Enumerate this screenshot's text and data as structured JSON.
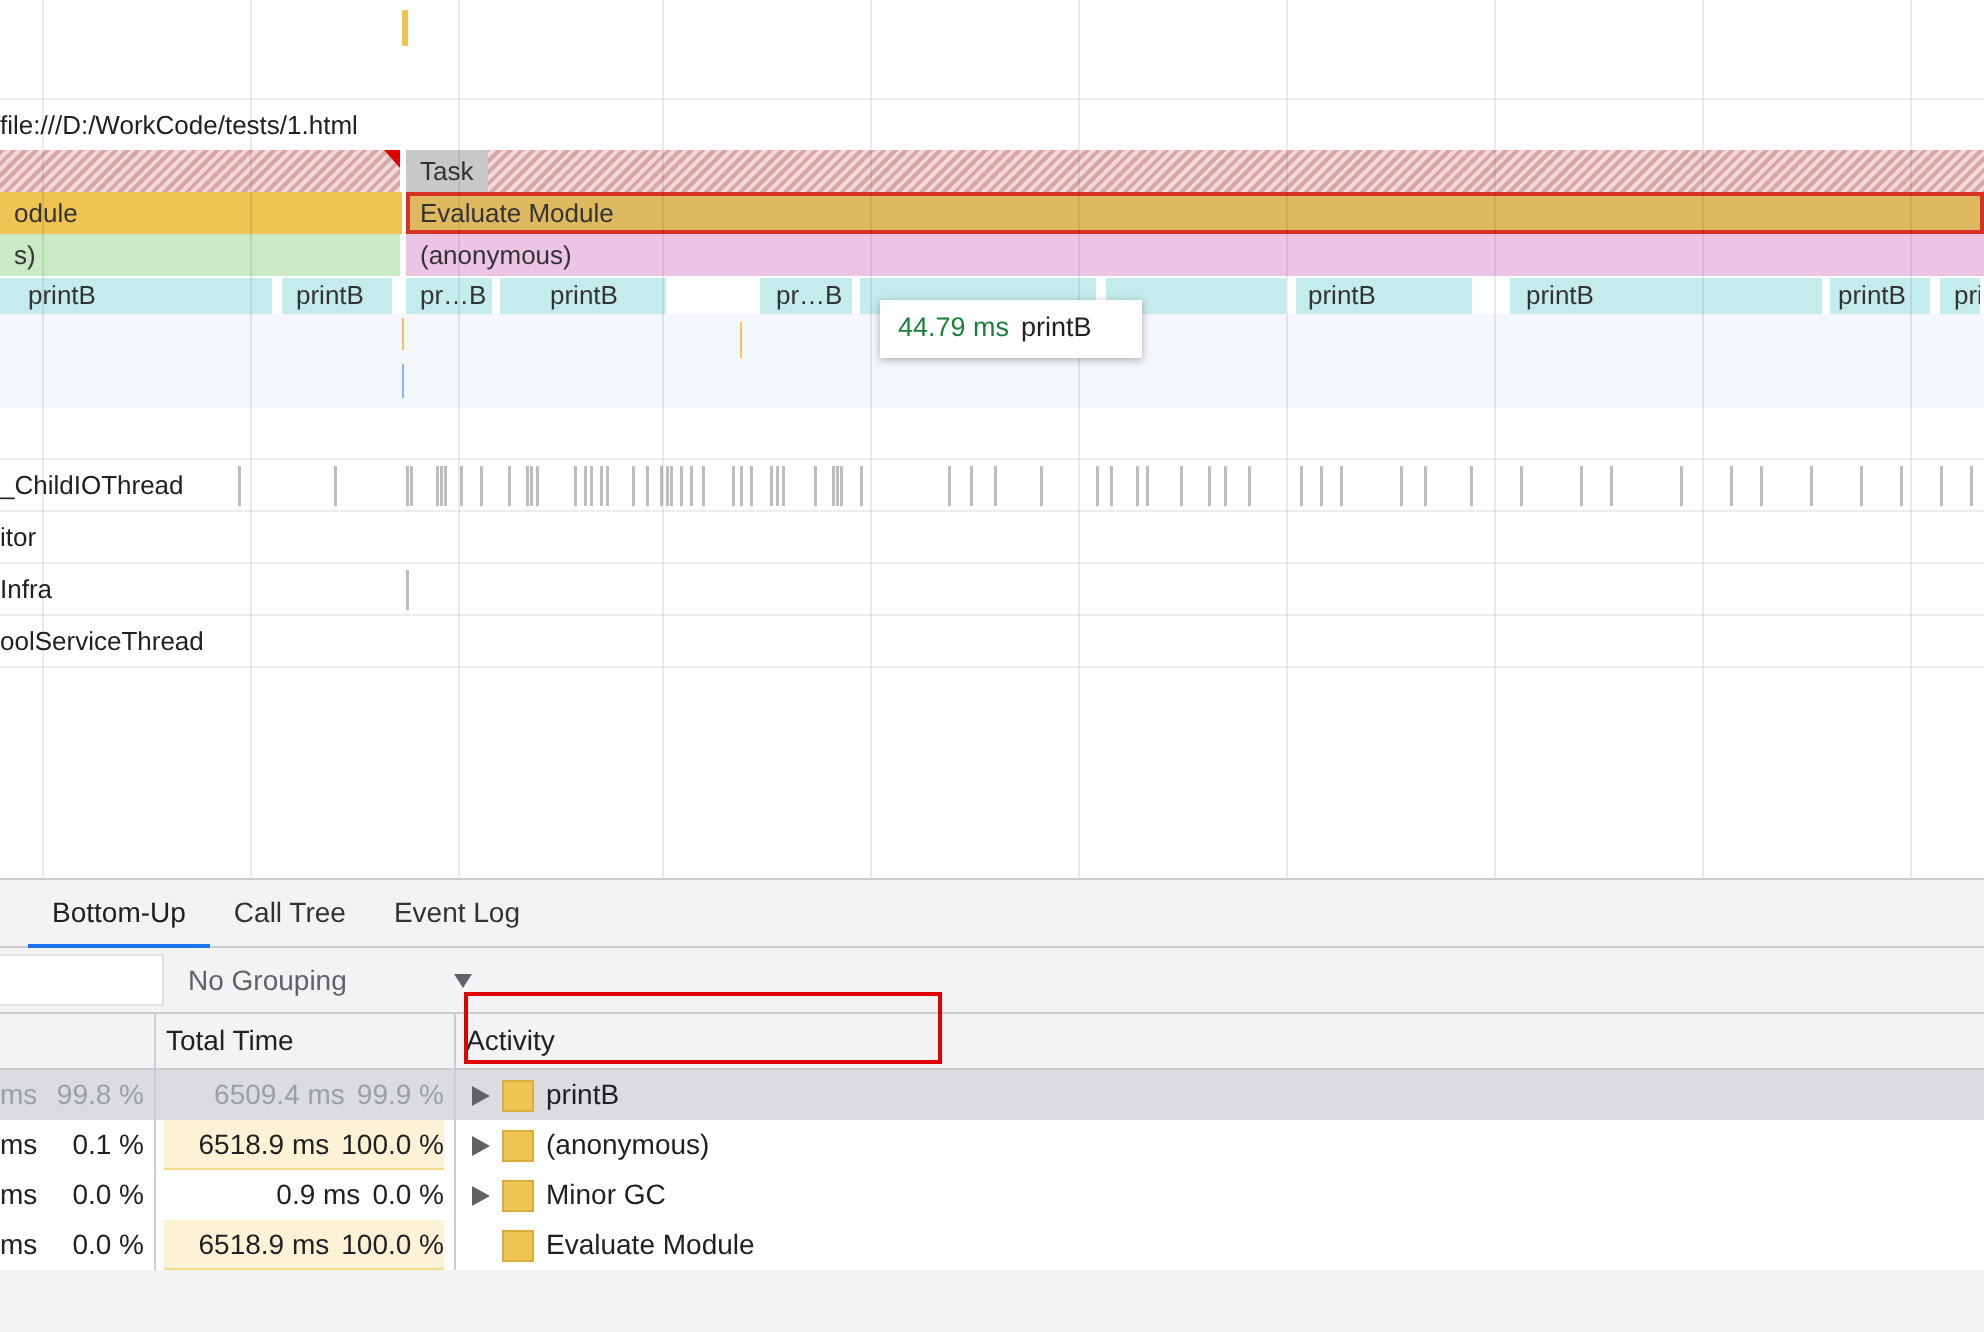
{
  "timeline": {
    "url": "file:///D:/WorkCode/tests/1.html"
  },
  "flame_rows": [
    {
      "blocks": [
        {
          "kind": "long-task"
        },
        {
          "kind": "long-task",
          "label": "Task"
        }
      ]
    },
    {
      "blocks": [
        {
          "kind": "event",
          "label": "odule",
          "color": "#f0c453",
          "selected": false
        },
        {
          "kind": "event",
          "label": "Evaluate Module",
          "color": "#dfb960",
          "selected": true
        }
      ]
    },
    {
      "blocks": [
        {
          "kind": "event",
          "label": "s)",
          "color": "#c9eac4",
          "selected": false
        },
        {
          "kind": "event",
          "label": "(anonymous)",
          "color": "#ecc5e4",
          "selected": false
        }
      ]
    },
    {
      "blocks": [
        {
          "kind": "event",
          "label": "printB"
        },
        {
          "kind": "event",
          "label": "printB"
        },
        {
          "kind": "event",
          "label": "pr…B"
        },
        {
          "kind": "event",
          "label": "printB"
        },
        {
          "kind": "event",
          "label": "pr…B"
        },
        {
          "kind": "event"
        },
        {
          "kind": "event"
        },
        {
          "kind": "event",
          "label": "printB"
        },
        {
          "kind": "event",
          "label": "printB"
        },
        {
          "kind": "event",
          "label": "printB"
        },
        {
          "kind": "event",
          "label": "pri"
        }
      ]
    }
  ],
  "tooltip": {
    "duration": "44.79 ms",
    "name": "printB"
  },
  "threads": [
    {
      "name": "_ChildIOThread"
    },
    {
      "name": "itor"
    },
    {
      "name": "Infra"
    },
    {
      "name": "oolServiceThread"
    }
  ],
  "details": {
    "tabs": [
      {
        "label": "Bottom-Up",
        "selected": true
      },
      {
        "label": "Call Tree",
        "selected": false
      },
      {
        "label": "Event Log",
        "selected": false
      }
    ],
    "grouping": "No Grouping",
    "columns": [
      "Total Time",
      "Activity"
    ],
    "rows": [
      {
        "self_time": "ms",
        "self_percent": "99.8 %",
        "total_time": "6509.4 ms",
        "total_percent": "99.9 %",
        "total_highlighted": false,
        "activity": "printB",
        "expandable": true,
        "selected": true
      },
      {
        "self_time": "ms",
        "self_percent": "0.1 %",
        "total_time": "6518.9 ms",
        "total_percent": "100.0 %",
        "total_highlighted": true,
        "activity": "(anonymous)",
        "expandable": true,
        "selected": false
      },
      {
        "self_time": "ms",
        "self_percent": "0.0 %",
        "total_time": "0.9 ms",
        "total_percent": "0.0 %",
        "total_highlighted": false,
        "activity": "Minor GC",
        "expandable": true,
        "selected": false
      },
      {
        "self_time": "ms",
        "self_percent": "0.0 %",
        "total_time": "6518.9 ms",
        "total_percent": "100.0 %",
        "total_highlighted": true,
        "activity": "Evaluate Module",
        "expandable": false,
        "selected": false
      }
    ]
  }
}
